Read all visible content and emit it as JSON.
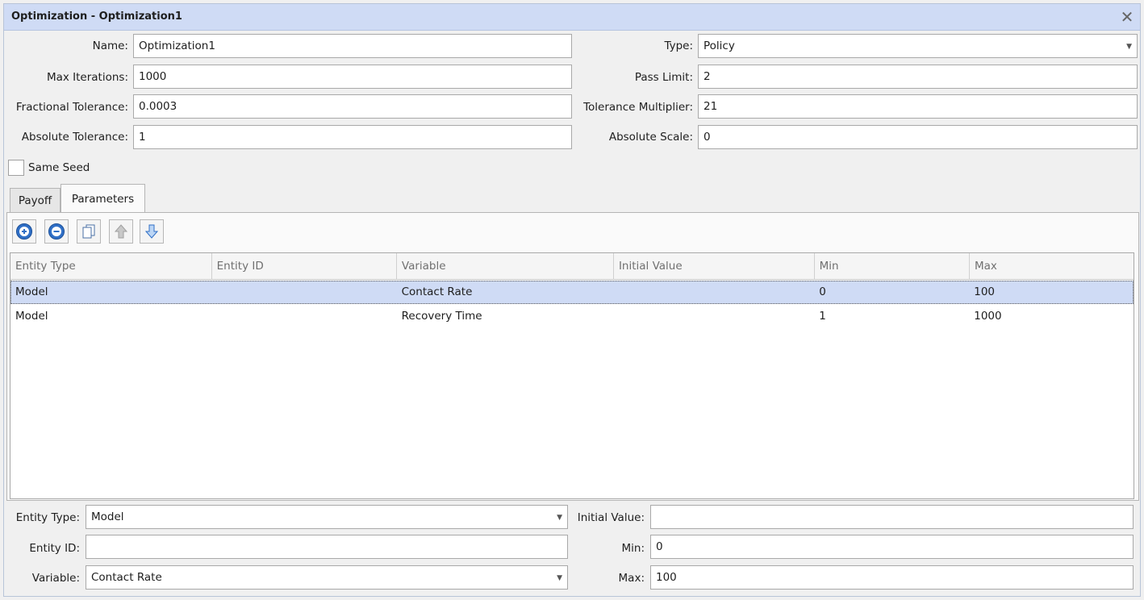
{
  "window": {
    "title": "Optimization - Optimization1",
    "close_glyph": "✕"
  },
  "form": {
    "name": {
      "label": "Name:",
      "value": "Optimization1"
    },
    "type": {
      "label": "Type:",
      "value": "Policy"
    },
    "max_iterations": {
      "label": "Max Iterations:",
      "value": "1000"
    },
    "pass_limit": {
      "label": "Pass Limit:",
      "value": "2"
    },
    "fractional_tolerance": {
      "label": "Fractional Tolerance:",
      "value": "0.0003"
    },
    "tolerance_multiplier": {
      "label": "Tolerance Multiplier:",
      "value": "21"
    },
    "absolute_tolerance": {
      "label": "Absolute Tolerance:",
      "value": "1"
    },
    "absolute_scale": {
      "label": "Absolute Scale:",
      "value": "0"
    },
    "same_seed": {
      "label": "Same Seed",
      "checked": false
    }
  },
  "tabs": [
    {
      "label": "Payoff",
      "active": false
    },
    {
      "label": "Parameters",
      "active": true
    }
  ],
  "toolbar": [
    {
      "icon": "add-circle-icon"
    },
    {
      "icon": "remove-circle-icon"
    },
    {
      "icon": "copy-icon"
    },
    {
      "icon": "arrow-up-icon"
    },
    {
      "icon": "arrow-down-icon"
    }
  ],
  "grid": {
    "columns": [
      "Entity Type",
      "Entity ID",
      "Variable",
      "Initial Value",
      "Min",
      "Max"
    ],
    "rows": [
      {
        "entity_type": "Model",
        "entity_id": "",
        "variable": "Contact Rate",
        "initial_value": "",
        "min": "0",
        "max": "100",
        "selected": true
      },
      {
        "entity_type": "Model",
        "entity_id": "",
        "variable": "Recovery Time",
        "initial_value": "",
        "min": "1",
        "max": "1000",
        "selected": false
      }
    ]
  },
  "editor": {
    "entity_type": {
      "label": "Entity Type:",
      "value": "Model"
    },
    "entity_id": {
      "label": "Entity ID:",
      "value": ""
    },
    "variable": {
      "label": "Variable:",
      "value": "Contact Rate"
    },
    "initial_value": {
      "label": "Initial Value:",
      "value": ""
    },
    "min": {
      "label": "Min:",
      "value": "0"
    },
    "max": {
      "label": "Max:",
      "value": "100"
    }
  },
  "colors": {
    "title_bar": "#cfdbf5",
    "selection": "#cfdbf5",
    "icon_blue": "#2f6fc6"
  }
}
